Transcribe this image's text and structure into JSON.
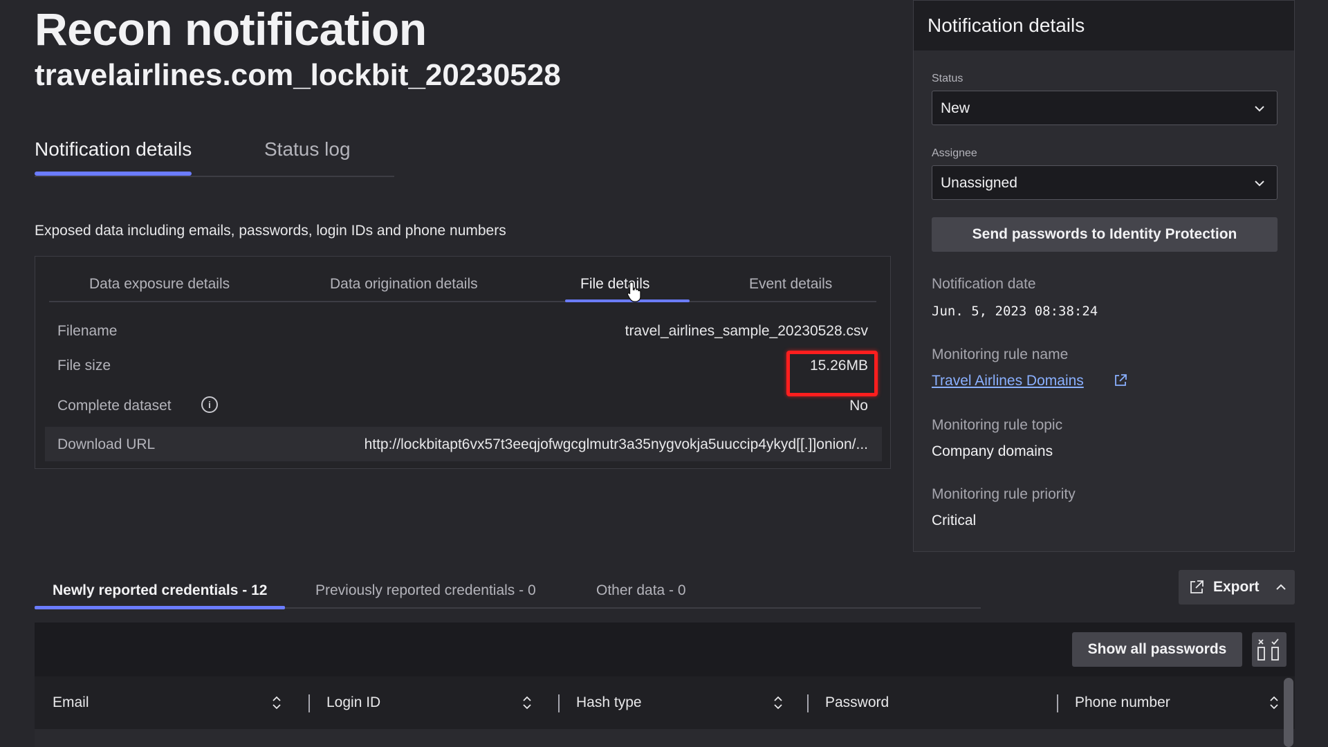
{
  "header": {
    "title": "Recon notification",
    "subtitle": "travelairlines.com_lockbit_20230528"
  },
  "main_tabs": [
    {
      "label": "Notification details",
      "active": true
    },
    {
      "label": "Status log",
      "active": false
    }
  ],
  "summary": "Exposed data including emails, passwords, login IDs and phone numbers",
  "sub_tabs": [
    {
      "label": "Data exposure details",
      "active": false
    },
    {
      "label": "Data origination details",
      "active": false
    },
    {
      "label": "File details",
      "active": true
    },
    {
      "label": "Event details",
      "active": false
    }
  ],
  "file_details": {
    "filename": {
      "label": "Filename",
      "value": "travel_airlines_sample_20230528.csv"
    },
    "file_size": {
      "label": "File size",
      "value": "15.26MB"
    },
    "complete_dataset": {
      "label": "Complete dataset",
      "value": "No",
      "info_icon": "info-icon"
    },
    "download_url": {
      "label": "Download URL",
      "value": "http://lockbitapt6vx57t3eeqjofwgcglmutr3a35nygvokja5uuccip4ykyd[[.]]onion/..."
    }
  },
  "side_panel": {
    "title": "Notification details",
    "status": {
      "label": "Status",
      "value": "New"
    },
    "assignee": {
      "label": "Assignee",
      "value": "Unassigned"
    },
    "send_button": "Send passwords to Identity Protection",
    "notification_date": {
      "label": "Notification date",
      "value": "Jun. 5, 2023 08:38:24"
    },
    "rule_name": {
      "label": "Monitoring rule name",
      "value": "Travel Airlines Domains"
    },
    "rule_topic": {
      "label": "Monitoring rule topic",
      "value": "Company domains"
    },
    "rule_priority": {
      "label": "Monitoring rule priority",
      "value": "Critical"
    }
  },
  "credential_tabs": [
    {
      "label": "Newly reported credentials - 12",
      "active": true
    },
    {
      "label": "Previously reported credentials - 0",
      "active": false
    },
    {
      "label": "Other data - 0",
      "active": false
    }
  ],
  "toolbar": {
    "export_label": "Export",
    "show_passwords_label": "Show all passwords"
  },
  "table": {
    "columns": [
      "Email",
      "Login ID",
      "Hash type",
      "Password",
      "Phone number"
    ]
  },
  "colors": {
    "accent": "#6b7cff",
    "highlight": "#ff1e1e",
    "link": "#8ab0ff"
  }
}
